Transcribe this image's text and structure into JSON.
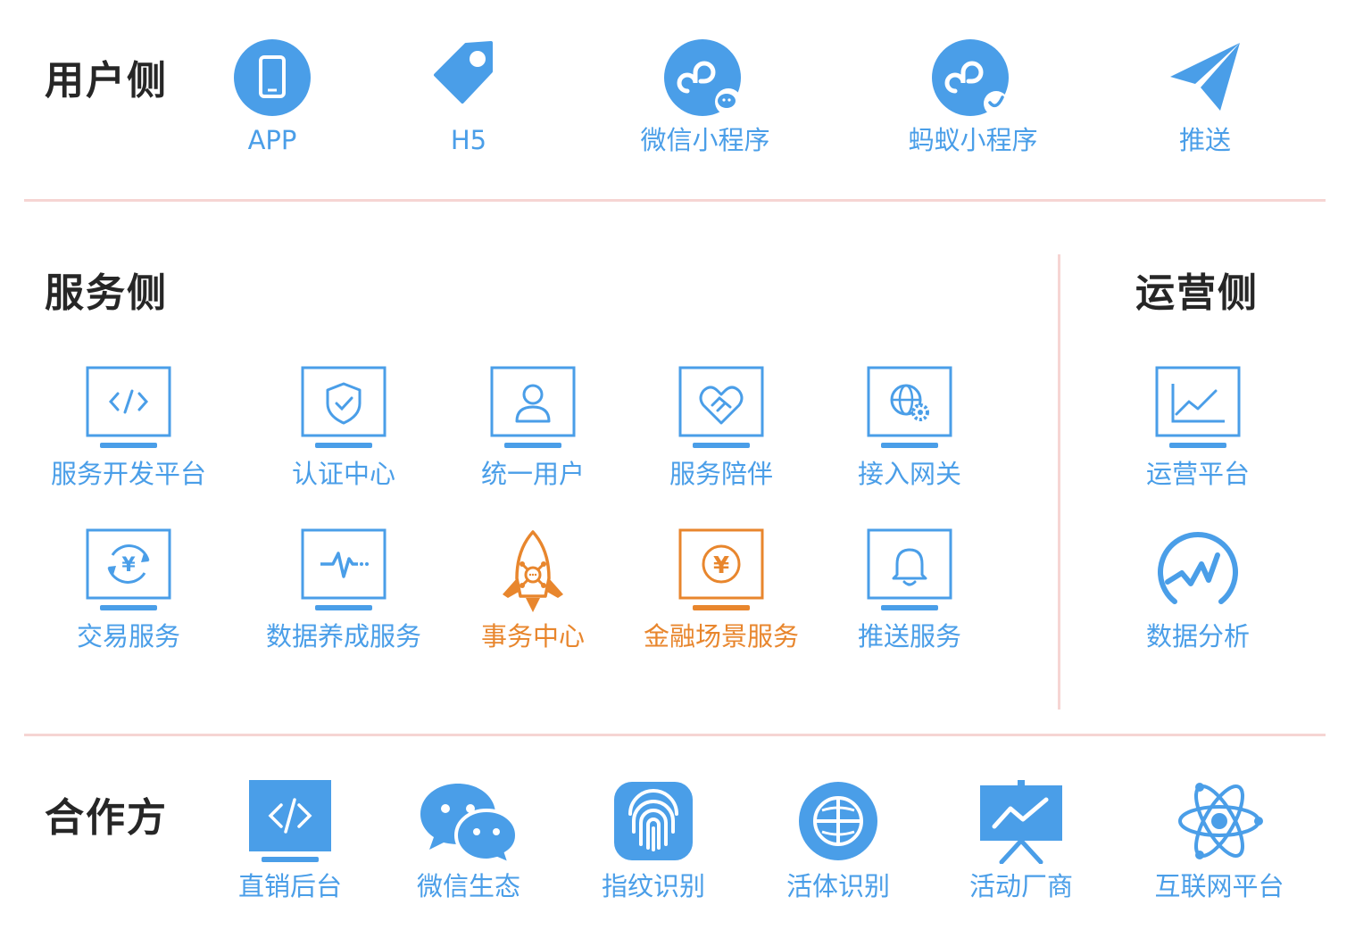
{
  "colors": {
    "blue": "#4a9ee8",
    "orange": "#e8862d",
    "divider": "#f6d5d3",
    "title": "#262626"
  },
  "user_side": {
    "title": "用户侧",
    "items": [
      {
        "label": "APP",
        "icon": "phone-icon"
      },
      {
        "label": "H5",
        "icon": "tag-icon"
      },
      {
        "label": "微信小程序",
        "icon": "wechat-miniprogram-icon"
      },
      {
        "label": "蚂蚁小程序",
        "icon": "ant-miniprogram-icon"
      },
      {
        "label": "推送",
        "icon": "paper-plane-icon"
      }
    ]
  },
  "service_side": {
    "title": "服务侧",
    "items": [
      {
        "label": "服务开发平台",
        "icon": "code-monitor-icon"
      },
      {
        "label": "认证中心",
        "icon": "shield-monitor-icon"
      },
      {
        "label": "统一用户",
        "icon": "user-monitor-icon"
      },
      {
        "label": "服务陪伴",
        "icon": "handshake-monitor-icon"
      },
      {
        "label": "接入网关",
        "icon": "globe-gear-monitor-icon"
      },
      {
        "label": "交易服务",
        "icon": "yen-cycle-monitor-icon"
      },
      {
        "label": "数据养成服务",
        "icon": "pulse-monitor-icon"
      },
      {
        "label": "事务中心",
        "icon": "rocket-icon",
        "highlight": true
      },
      {
        "label": "金融场景服务",
        "icon": "yen-monitor-icon",
        "highlight": true
      },
      {
        "label": "推送服务",
        "icon": "bell-monitor-icon"
      }
    ]
  },
  "ops_side": {
    "title": "运营侧",
    "items": [
      {
        "label": "运营平台",
        "icon": "chart-monitor-icon"
      },
      {
        "label": "数据分析",
        "icon": "analytics-gauge-icon"
      }
    ]
  },
  "partners": {
    "title": "合作方",
    "items": [
      {
        "label": "直销后台",
        "icon": "code-screen-icon"
      },
      {
        "label": "微信生态",
        "icon": "wechat-icon"
      },
      {
        "label": "指纹识别",
        "icon": "fingerprint-icon"
      },
      {
        "label": "活体识别",
        "icon": "face-globe-icon"
      },
      {
        "label": "活动厂商",
        "icon": "presentation-icon"
      },
      {
        "label": "互联网平台",
        "icon": "atom-icon"
      }
    ]
  }
}
